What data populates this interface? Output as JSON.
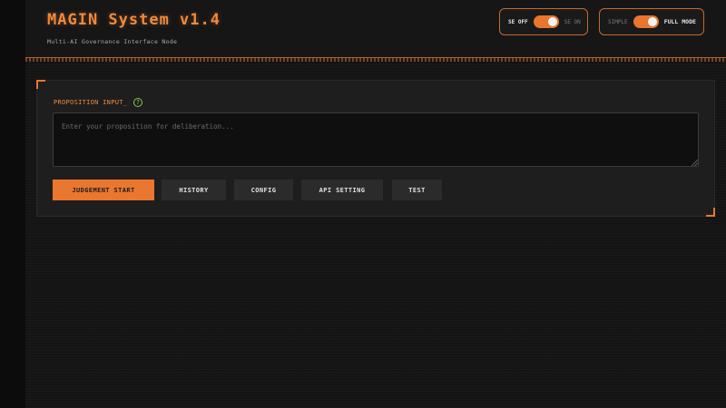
{
  "header": {
    "title": "MAGIN System v1.4",
    "subtitle": "Multi-AI Governance Interface Node"
  },
  "toggles": {
    "se": {
      "off_label": "SE OFF",
      "on_label": "SE ON",
      "state": "off"
    },
    "mode": {
      "simple_label": "SIMPLE",
      "full_label": "FULL MODE",
      "state": "full"
    }
  },
  "proposition": {
    "label": "PROPOSITION INPUT_",
    "help_icon": "?",
    "value": "",
    "placeholder": "Enter your proposition for deliberation..."
  },
  "actions": {
    "judgement": "JUDGEMENT START",
    "history": "HISTORY",
    "config": "CONFIG",
    "api": "API SETTING",
    "test": "TEST"
  },
  "colors": {
    "accent": "#ea7730",
    "background": "#141414",
    "panel": "#1e1e1e",
    "help": "#8fc24a"
  }
}
